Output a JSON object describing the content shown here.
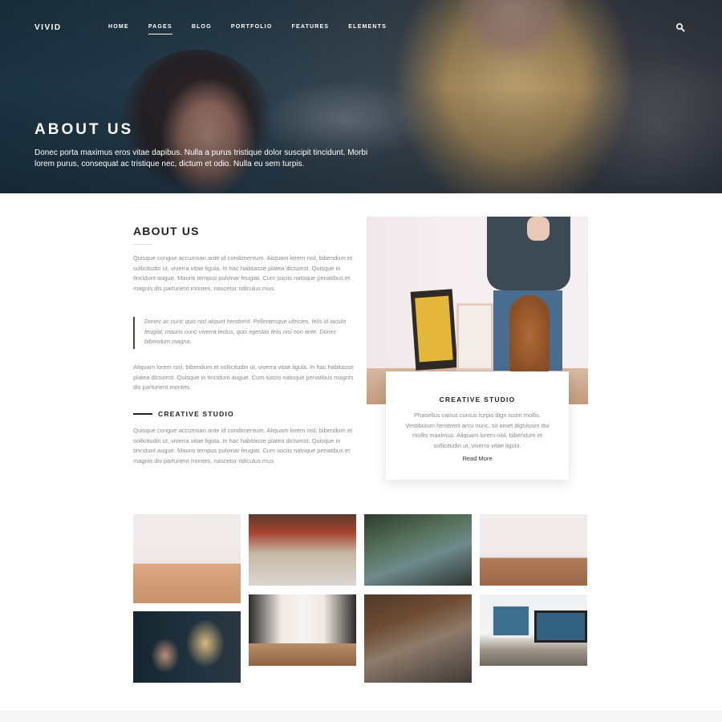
{
  "brand": {
    "logo": "VIVID"
  },
  "nav": {
    "items": [
      {
        "label": "HOME",
        "active": false
      },
      {
        "label": "PAGES",
        "active": true
      },
      {
        "label": "BLOG",
        "active": false
      },
      {
        "label": "PORTFOLIO",
        "active": false
      },
      {
        "label": "FEATURES",
        "active": false
      },
      {
        "label": "ELEMENTS",
        "active": false
      }
    ],
    "search_icon": "search-icon"
  },
  "hero": {
    "title": "ABOUT US",
    "subtitle": "Donec porta maximus eros vitae dapibus. Nulla a purus tristique dolor suscipit tincidunt. Morbi lorem purus, consequat ac tristique nec, dictum et odio. Nulla eu sem turpis."
  },
  "about": {
    "heading": "ABOUT US",
    "paragraph1": "Quisque congue accumsan ante id condimentum. Aliquam lorem nisl, bibendum et sollicitudin ut, viverra vitae ligula. In hac habitasse platea dictumst. Quisque in tincidunt augue. Mauris tempus pulvinar feugiat. Cum sociis natoque penatibus et magnis dis parturient montes, nascetur ridiculus mus.",
    "quote": "Donec ac nunc quis nisl aliquet hendrerit. Pellentesque ultricies, felis id iaculis feugiat, mauris nunc viverra lectus, quis egestas felis nisi non ante. Donec bibendum magna.",
    "paragraph2": "Aliquam lorem nisl, bibendum et sollicitudin ut, viverra vitae ligula. In hac habitasse platea dictumst. Quisque in tincidunt augue. Cum sociis natoque penatibus magnis dis parturient montes.",
    "studio_heading": "CREATIVE STUDIO",
    "paragraph3": "Quisque congue accumsan ante id condimentum. Aliquam lorem nisl, bibendum et sollicitudin ut, viverra vitae ligula. In hac habitasse platea dictumst. Quisque in tincidunt augue. Mauris tempus pulvinar feugiat. Cum sociis natoque penatibus et magnis dis parturient montes, nascetur ridiculus mus."
  },
  "card": {
    "title": "CREATIVE STUDIO",
    "text": "Phasellus varius cursus turpis dign issim mollis. Vestibulum hendrerit arcu nunc, sit amet dignissim dui mollis maximus. Aliquam lorem nisl, bibendum et sollicitudin ut, viverra vitae ligula.",
    "link": "Read More"
  },
  "gallery": {
    "items": [
      "office-table",
      "food-cart",
      "office-plants",
      "kitchen-table",
      "two-women-laptop",
      "hallway",
      "loft-office",
      "desk-monitors"
    ]
  },
  "colors": {
    "quote_border": "#4a4a2e",
    "body_text": "#8a8a8a",
    "heading_text": "#222222"
  }
}
